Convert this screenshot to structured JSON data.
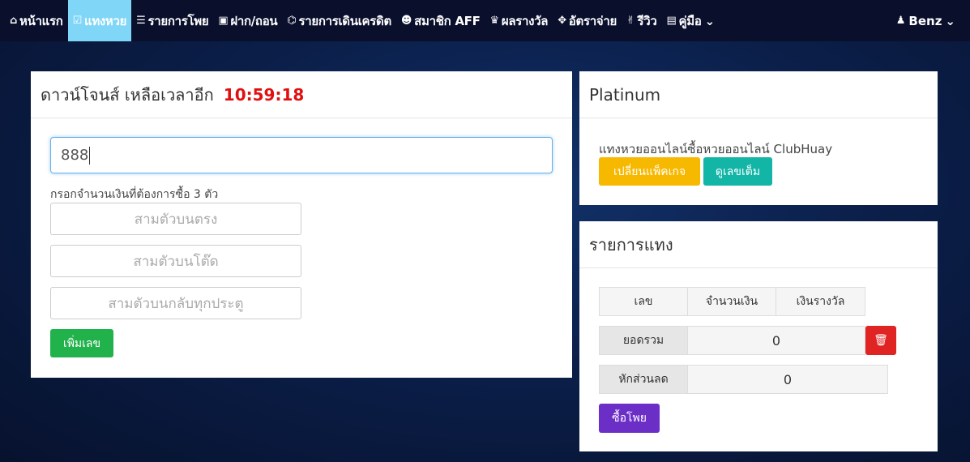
{
  "nav": {
    "items": [
      {
        "icon": "home-icon",
        "glyph": "⌂",
        "label": "หน้าแรก",
        "active": false
      },
      {
        "icon": "check-square-icon",
        "glyph": "☑",
        "label": "แทงหวย",
        "active": true
      },
      {
        "icon": "list-icon",
        "glyph": "☰",
        "label": "รายการโพย",
        "active": false
      },
      {
        "icon": "money-icon",
        "glyph": "▣",
        "label": "ฝาก/ถอน",
        "active": false
      },
      {
        "icon": "bank-icon",
        "glyph": "⌬",
        "label": "รายการเดินเครดิต",
        "active": false
      },
      {
        "icon": "users-icon",
        "glyph": "☻",
        "label": "สมาชิก AFF",
        "active": false
      },
      {
        "icon": "trophy-icon",
        "glyph": "♛",
        "label": "ผลรางวัล",
        "active": false
      },
      {
        "icon": "crosshair-icon",
        "glyph": "✥",
        "label": "อัตราจ่าย",
        "active": false
      },
      {
        "icon": "thumbs-up-icon",
        "glyph": "✌",
        "label": "รีวิว",
        "active": false
      },
      {
        "icon": "book-icon",
        "glyph": "▤",
        "label": "คู่มือ",
        "active": false,
        "caret": "⌄"
      }
    ],
    "user": {
      "glyph": "♟",
      "label": "Benz",
      "caret": "⌄"
    }
  },
  "bet_panel": {
    "title": "ดาวน์โจนส์ เหลือเวลาอีก",
    "timer": "10:59:18",
    "number_value": "888",
    "hint": "กรอกจำนวนเงินที่ต้องการซื้อ 3 ตัว",
    "fields": [
      {
        "placeholder": "สามตัวบนตรง"
      },
      {
        "placeholder": "สามตัวบนโต๊ด"
      },
      {
        "placeholder": "สามตัวบนกลับทุกประตู"
      }
    ],
    "add_button": "เพิ่มเลข"
  },
  "package_panel": {
    "title": "Platinum",
    "description": "แทงหวยออนไลน์ซื้อหวยออนไลน์ ClubHuay",
    "change_button": "เปลี่ยนแพ็คเกจ",
    "view_button": "ดูเลขเต็ม"
  },
  "list_panel": {
    "title": "รายการแทง",
    "columns": [
      "เลข",
      "จำนวนเงิน",
      "เงินรางวัล"
    ],
    "total_label": "ยอดรวม",
    "total_value": "0",
    "discount_label": "หักส่วนลด",
    "discount_value": "0",
    "buy_button": "ซื้อโพย",
    "delete_glyph": "🗑"
  },
  "colors": {
    "topbar": "#0a0f2c",
    "active_tab": "#7fd6f7",
    "timer": "#e01010",
    "add_button": "#22b24c",
    "change_button": "#f7b800",
    "view_button": "#12b5a6",
    "delete_button": "#e02424",
    "buy_button": "#6b2fc7"
  }
}
